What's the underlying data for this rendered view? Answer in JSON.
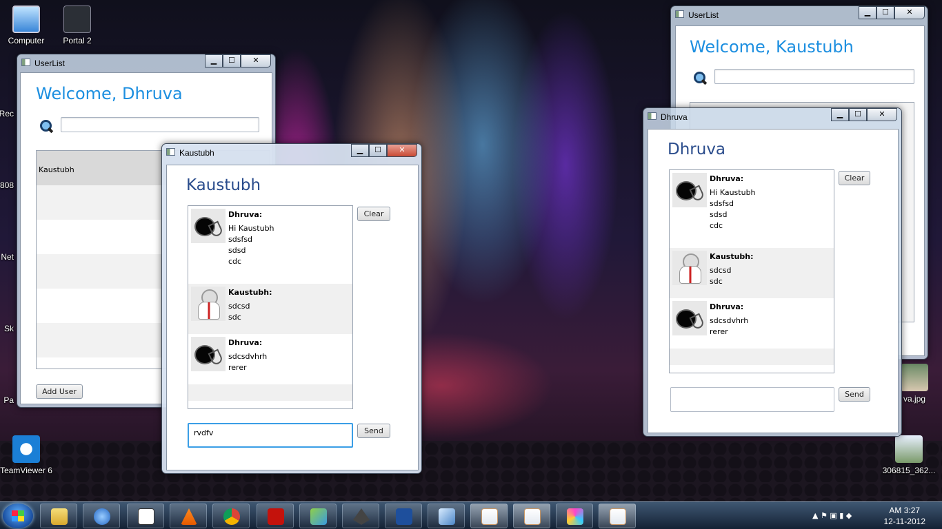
{
  "desktop": {
    "icons": [
      {
        "label": "Computer"
      },
      {
        "label": "Portal 2"
      },
      {
        "label": "TeamViewer 6"
      },
      {
        "label": "va.jpg"
      },
      {
        "label": "306815_362..."
      }
    ],
    "partial_left_labels": [
      "Rec",
      "808",
      "Net",
      "Sk",
      "Pa"
    ]
  },
  "userlist_left": {
    "window_title": "UserList",
    "welcome": "Welcome, Dhruva",
    "search_value": "",
    "users": [
      "Kaustubh"
    ],
    "add_user_label": "Add User"
  },
  "userlist_right": {
    "window_title": "UserList",
    "welcome": "Welcome, Kaustubh",
    "search_value": ""
  },
  "chat_kaustubh": {
    "window_title": "Kaustubh",
    "heading": "Kaustubh",
    "clear_label": "Clear",
    "send_label": "Send",
    "input_value": "rvdfv",
    "messages": [
      {
        "sender": "Dhruva:",
        "lines": [
          "Hi Kaustubh",
          "sdsfsd",
          "sdsd",
          "cdc"
        ]
      },
      {
        "sender": "Kaustubh:",
        "lines": [
          "sdcsd",
          "sdc"
        ]
      },
      {
        "sender": "Dhruva:",
        "lines": [
          "sdcsdvhrh",
          "rerer"
        ]
      }
    ]
  },
  "chat_dhruva": {
    "window_title": "Dhruva",
    "heading": "Dhruva",
    "clear_label": "Clear",
    "send_label": "Send",
    "input_value": "",
    "messages": [
      {
        "sender": "Dhruva:",
        "lines": [
          "Hi Kaustubh",
          "sdsfsd",
          "sdsd",
          "cdc"
        ]
      },
      {
        "sender": "Kaustubh:",
        "lines": [
          "sdcsd",
          "sdc"
        ]
      },
      {
        "sender": "Dhruva:",
        "lines": [
          "sdcsdvhrh",
          "rerer"
        ]
      }
    ]
  },
  "taskbar": {
    "time": "AM 3:27",
    "date": "12-11-2012",
    "pinned": [
      "explorer-icon",
      "itunes-icon",
      "zend-icon",
      "vlc-icon",
      "chrome-icon",
      "acrobat-icon",
      "windows-live-icon",
      "inkscape-icon",
      "powershell-icon",
      "virtualbox-icon",
      "java-icon",
      "java-icon",
      "netbeans-icon",
      "java-icon"
    ]
  },
  "colors": {
    "welcome_blue": "#1d8fe0",
    "chat_heading_blue": "#2a4c8c",
    "focus_border": "#3a9ee6"
  }
}
